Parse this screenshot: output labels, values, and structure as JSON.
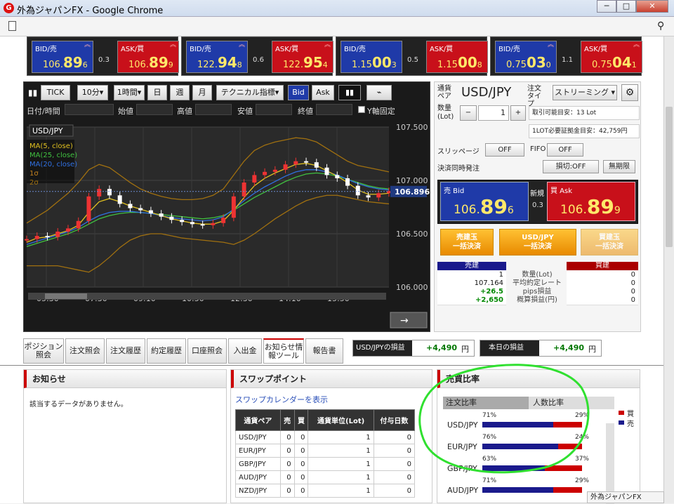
{
  "window": {
    "title": "外為ジャパンFX - Google Chrome",
    "minimize": "─",
    "maximize": "□",
    "close": "✕"
  },
  "quotes": [
    {
      "bid_label": "BID/売",
      "bid_prefix": "106.",
      "bid_big": "89",
      "bid_small": "6",
      "spread": "0.3",
      "ask_label": "ASK/買",
      "ask_prefix": "106.",
      "ask_big": "89",
      "ask_small": "9"
    },
    {
      "bid_label": "BID/売",
      "bid_prefix": "122.",
      "bid_big": "94",
      "bid_small": "8",
      "spread": "0.6",
      "ask_label": "ASK/買",
      "ask_prefix": "122.",
      "ask_big": "95",
      "ask_small": "4"
    },
    {
      "bid_label": "BID/売",
      "bid_prefix": "1.15",
      "bid_big": "00",
      "bid_small": "3",
      "spread": "0.5",
      "ask_label": "ASK/買",
      "ask_prefix": "1.15",
      "ask_big": "00",
      "ask_small": "8"
    },
    {
      "bid_label": "BID/売",
      "bid_prefix": "0.75",
      "bid_big": "03",
      "bid_small": "0",
      "spread": "1.1",
      "ask_label": "ASK/買",
      "ask_prefix": "0.75",
      "ask_big": "04",
      "ask_small": "1"
    }
  ],
  "chart_toolbar": {
    "tick": "TICK",
    "interval": "10分▾",
    "period": "1時間▾",
    "day": "日",
    "week": "週",
    "month": "月",
    "technical": "テクニカル指標▾",
    "bid": "Bid",
    "ask": "Ask"
  },
  "ohlc": {
    "datetime": "日付/時間",
    "open": "始値",
    "high": "高値",
    "low": "安値",
    "close": "終値",
    "yfix": "Y軸固定"
  },
  "chart_data": {
    "type": "line",
    "symbol": "USD/JPY",
    "legend": [
      "MA(5, close)",
      "MA(25, close)",
      "MA(20, close)",
      "1σ",
      "2σ"
    ],
    "legend_colors": [
      "#e0c020",
      "#40c040",
      "#3070e0",
      "#c08020",
      "#a07010"
    ],
    "current_price": "106.896",
    "y_ticks": [
      "107.500",
      "107.000",
      "106.500",
      "106.000"
    ],
    "x_ticks": [
      "05:30",
      "07:30",
      "09:10",
      "10:50",
      "12:30",
      "14:10",
      "15:50"
    ],
    "ylim": [
      106.0,
      107.5
    ],
    "close": [
      106.45,
      106.48,
      106.47,
      106.52,
      106.55,
      106.62,
      106.85,
      106.92,
      106.86,
      106.78,
      106.74,
      106.72,
      106.69,
      106.66,
      106.63,
      106.61,
      106.59,
      106.58,
      106.6,
      106.65,
      106.85,
      106.98,
      107.05,
      107.08,
      107.1,
      107.15,
      107.18,
      107.17,
      107.12,
      107.05,
      107.02,
      106.95,
      106.86,
      106.84,
      106.88,
      106.9
    ],
    "ma5": [
      106.42,
      106.46,
      106.47,
      106.5,
      106.53,
      106.58,
      106.7,
      106.8,
      106.83,
      106.8,
      106.76,
      106.73,
      106.7,
      106.67,
      106.64,
      106.62,
      106.6,
      106.59,
      106.59,
      106.62,
      106.72,
      106.84,
      106.95,
      107.02,
      107.07,
      107.11,
      107.15,
      107.16,
      107.14,
      107.09,
      107.04,
      106.98,
      106.91,
      106.87,
      106.87,
      106.88
    ],
    "ma25": [
      106.38,
      106.41,
      106.44,
      106.47,
      106.5,
      106.54,
      106.59,
      106.64,
      106.67,
      106.69,
      106.7,
      106.7,
      106.69,
      106.68,
      106.67,
      106.66,
      106.65,
      106.64,
      106.65,
      106.67,
      106.72,
      106.78,
      106.84,
      106.89,
      106.94,
      106.99,
      107.03,
      107.06,
      107.07,
      107.06,
      107.04,
      107.01,
      106.98,
      106.95,
      106.93,
      106.92
    ],
    "ma20": [
      106.4,
      106.43,
      106.46,
      106.49,
      106.52,
      106.56,
      106.62,
      106.67,
      106.7,
      106.71,
      106.71,
      106.7,
      106.69,
      106.67,
      106.65,
      106.64,
      106.63,
      106.62,
      106.63,
      106.66,
      106.73,
      106.81,
      106.88,
      106.94,
      106.99,
      107.04,
      107.08,
      107.1,
      107.1,
      107.08,
      107.05,
      107.01,
      106.97,
      106.94,
      106.92,
      106.91
    ],
    "band_up": [
      106.6,
      106.66,
      106.72,
      106.8,
      106.88,
      106.98,
      107.1,
      107.15,
      107.12,
      107.05,
      106.98,
      106.92,
      106.88,
      106.85,
      106.83,
      106.82,
      106.82,
      106.83,
      106.86,
      106.92,
      107.05,
      107.18,
      107.28,
      107.33,
      107.36,
      107.38,
      107.4,
      107.39,
      107.36,
      107.3,
      107.24,
      107.18,
      107.14,
      107.12,
      107.1,
      107.08
    ],
    "band_lo": [
      106.2,
      106.2,
      106.2,
      106.2,
      106.18,
      106.16,
      106.14,
      106.2,
      106.28,
      106.37,
      106.44,
      106.48,
      106.5,
      106.5,
      106.48,
      106.46,
      106.45,
      106.44,
      106.43,
      106.42,
      106.4,
      106.44,
      106.5,
      106.57,
      106.64,
      106.7,
      106.76,
      106.81,
      106.84,
      106.86,
      106.86,
      106.84,
      106.82,
      106.8,
      106.79,
      106.78
    ]
  },
  "trade": {
    "pair_label": "通貨ペア",
    "pair": "USD/JPY",
    "order_type_label": "注文タイプ",
    "order_type": "ストリーミング ▾",
    "qty_label": "数量(Lot)",
    "minus": "−",
    "qty": "1",
    "plus": "+",
    "available": "取引可能目安：13 Lot",
    "margin": "1LOT必要証拠金目安：42,759円",
    "slippage_label": "スリッページ",
    "slippage": "OFF",
    "fifo_label": "FIFO",
    "fifo": "OFF",
    "settle_label": "決済同時発注",
    "stop": "損切:OFF",
    "expiry": "無期限",
    "sell_label": "売 Bid",
    "sell_prefix": "106.",
    "sell_big": "89",
    "sell_small": "6",
    "new_label": "新規",
    "spread": "0.3",
    "buy_label": "買 Ask",
    "buy_prefix": "106.",
    "buy_big": "89",
    "buy_small": "9",
    "btn_sell_settle": "売建玉\n一括決済",
    "btn_pair_settle": "USD/JPY\n一括決済",
    "btn_buy_settle": "買建玉\n一括決済",
    "pos_sell": "売建",
    "pos_buy": "買建",
    "rows": [
      {
        "sell": "1",
        "label": "数量(Lot)",
        "buy": "0"
      },
      {
        "sell": "107.164",
        "label": "平均約定レート",
        "buy": "0"
      },
      {
        "sell": "+26.5",
        "label": "pips損益",
        "buy": "0"
      },
      {
        "sell": "+2,650",
        "label": "概算損益(円)",
        "buy": "0"
      }
    ]
  },
  "tabs": [
    "ポジション照会",
    "注文照会",
    "注文履歴",
    "約定履歴",
    "口座照会",
    "入出金",
    "お知らせ情報ツール",
    "報告書"
  ],
  "pl": {
    "pair_label": "USD/JPYの損益",
    "pair_value": "+4,490",
    "today_label": "本日の損益",
    "today_value": "+4,490",
    "unit": "円"
  },
  "news": {
    "title": "お知らせ",
    "empty": "該当するデータがありません。"
  },
  "swap": {
    "title": "スワップポイント",
    "link": "スワップカレンダーを表示",
    "headers": [
      "通貨ペア",
      "売",
      "買",
      "通貨単位(Lot)",
      "付与日数"
    ],
    "rows": [
      [
        "USD/JPY",
        "0",
        "0",
        "1",
        "0"
      ],
      [
        "EUR/JPY",
        "0",
        "0",
        "1",
        "0"
      ],
      [
        "GBP/JPY",
        "0",
        "0",
        "1",
        "0"
      ],
      [
        "AUD/JPY",
        "0",
        "0",
        "1",
        "0"
      ],
      [
        "NZD/JPY",
        "0",
        "0",
        "1",
        "0"
      ]
    ]
  },
  "ratio": {
    "title": "売買比率",
    "tab1": "注文比率",
    "tab2": "人数比率",
    "legend_buy": "買",
    "legend_sell": "売",
    "rows": [
      {
        "pair": "USD/JPY",
        "sell": "71%",
        "buy": "29%",
        "sell_frac": 0.71
      },
      {
        "pair": "EUR/JPY",
        "sell": "76%",
        "buy": "24%",
        "sell_frac": 0.76
      },
      {
        "pair": "GBP/JPY",
        "sell": "63%",
        "buy": "37%",
        "sell_frac": 0.63
      },
      {
        "pair": "AUD/JPY",
        "sell": "71%",
        "buy": "29%",
        "sell_frac": 0.71
      }
    ]
  },
  "taskbar": {
    "label": "外為ジャパンFX"
  }
}
